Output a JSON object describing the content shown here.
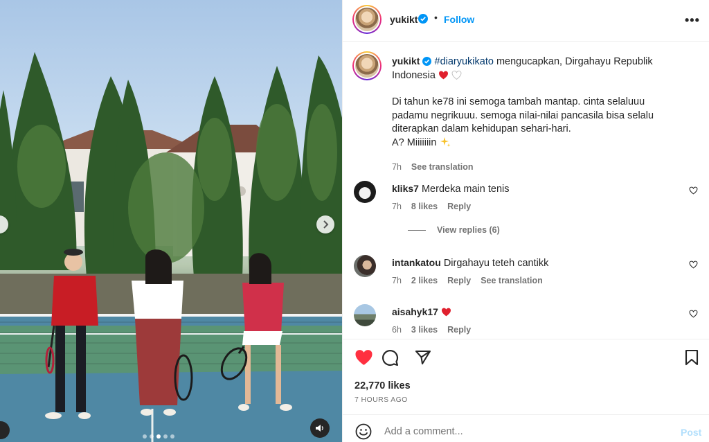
{
  "post": {
    "username": "yukikt",
    "follow_label": "Follow",
    "separator": "•",
    "more_icon": "more-horizontal-icon",
    "carousel": {
      "slide_count": 5,
      "active_slide": 3
    }
  },
  "caption": {
    "username": "yukikt",
    "hashtag": "#diaryukikato",
    "line1_rest": " mengucapkan, Dirgahayu Republik Indonesia",
    "para2_line1": "Di tahun ke78 ini semoga tambah mantap. cinta selaluuu",
    "para2_line2": "padamu negrikuuu. semoga nilai-nilai pancasila bisa selalu",
    "para2_line3": "diterapkan dalam kehidupan sehari-hari.",
    "para2_line4": "A? Miiiiiiin",
    "time": "7h",
    "see_translation": "See translation"
  },
  "comments": [
    {
      "username": "kliks7",
      "text": "Merdeka main tenis",
      "time": "7h",
      "likes": "8 likes",
      "reply": "Reply",
      "view_replies": "View replies (6)"
    },
    {
      "username": "intankatou",
      "text": "Dirgahayu teteh cantikk",
      "time": "7h",
      "likes": "2 likes",
      "reply": "Reply",
      "see_translation": "See translation"
    },
    {
      "username": "aisahyk17",
      "text": "",
      "time": "6h",
      "likes": "3 likes",
      "reply": "Reply"
    }
  ],
  "actions": {
    "likes": "22,770 likes",
    "time_ago": "7 HOURS AGO",
    "liked": true
  },
  "add_comment": {
    "placeholder": "Add a comment...",
    "post_label": "Post"
  },
  "colors": {
    "accent": "#0095f6",
    "heart": "#ff3040",
    "muted": "#737373"
  }
}
